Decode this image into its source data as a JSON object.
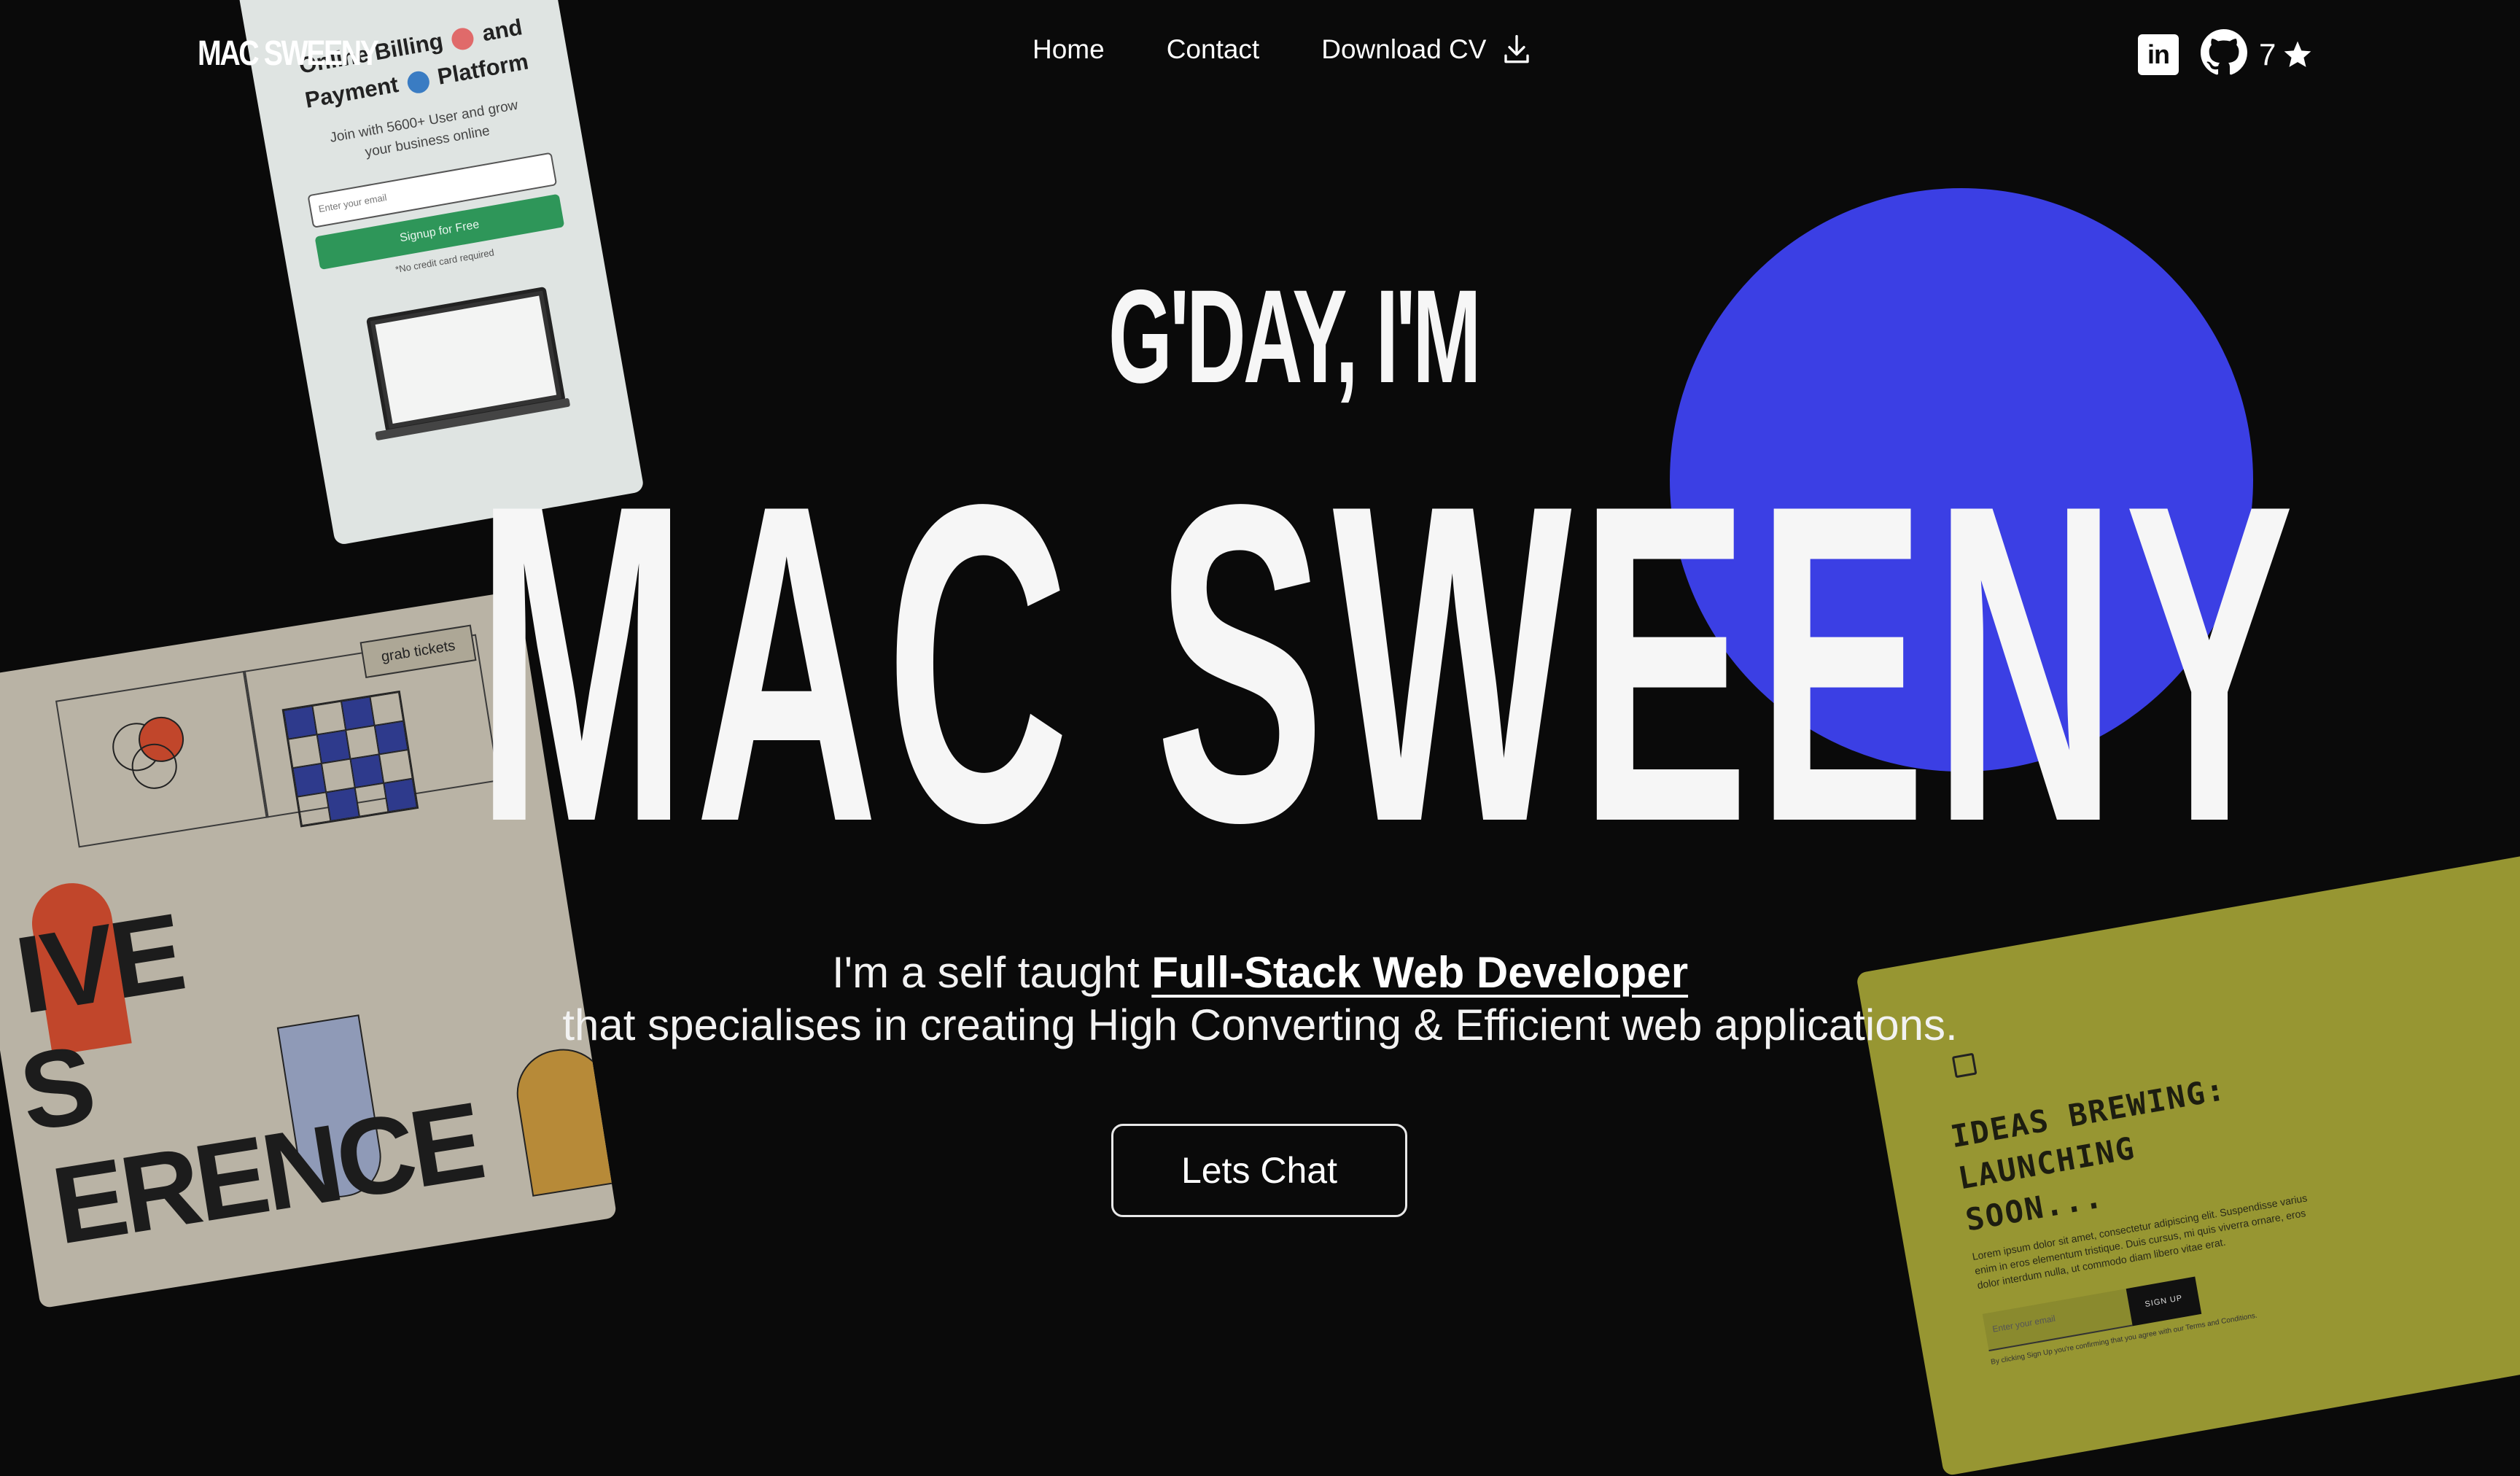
{
  "nav": {
    "logo": "MAC SWEENY",
    "links": [
      "Home",
      "Contact",
      "Download CV"
    ],
    "github_stars": "7"
  },
  "hero": {
    "greeting": "G'DAY, I'M",
    "name": "MAC SWEENY",
    "tagline_prefix": "I'm a self taught ",
    "tagline_highlight": "Full-Stack Web Developer",
    "tagline_line2": "that specialises in creating High Converting & Efficient web applications.",
    "cta_label": "Lets Chat"
  },
  "cards": {
    "billing": {
      "title_line1_a": "Online Billing",
      "title_line1_b": "and",
      "title_line2_a": "Payment",
      "title_line2_b": "Platform",
      "subtitle_line1": "Join with 5600+ User and grow",
      "subtitle_line2": "your business online",
      "email_placeholder": "Enter your email",
      "signup_label": "Signup for Free",
      "note": "*No credit card required"
    },
    "conference": {
      "tickets_label": "grab tickets",
      "word_top": "IVE",
      "word_mid": "S",
      "word_bottom": "ERENCE"
    },
    "brewing": {
      "title_l1": "IDEAS BREWING:",
      "title_l2": "LAUNCHING",
      "title_l3": "SOON...",
      "lorem": "Lorem ipsum dolor sit amet, consectetur adipiscing elit. Suspendisse varius enim in eros elementum tristique. Duis cursus, mi quis viverra ornare, eros dolor interdum nulla, ut commodo diam libero vitae erat.",
      "input_placeholder": "Enter your email",
      "signup_label": "SIGN UP",
      "terms": "By clicking Sign Up you're confirming that you agree with our Terms and Conditions."
    }
  },
  "colors": {
    "background": "#0a0a0a",
    "accent_circle": "#3b3fe4",
    "text": "#f6f6f6"
  }
}
